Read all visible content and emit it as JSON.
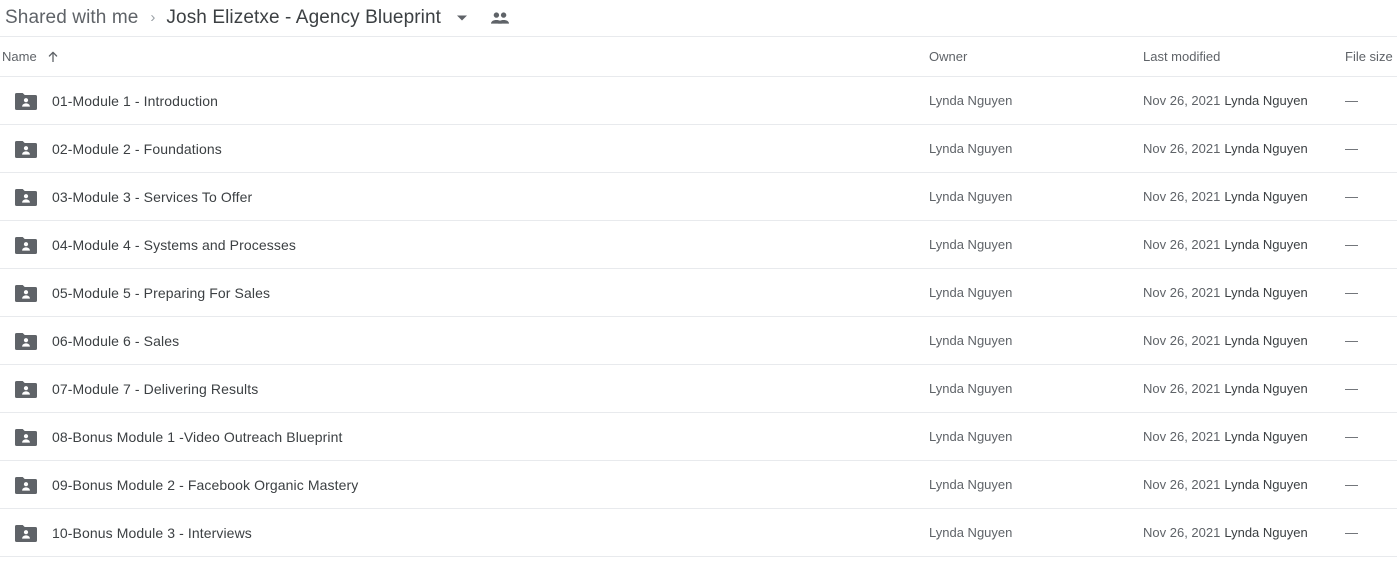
{
  "breadcrumb": {
    "root_label": "Shared with me",
    "separator": "›",
    "current_label": "Josh Elizetxe - Agency Blueprint",
    "caret_icon": "chevron-down-icon",
    "people_icon": "people-shared-icon"
  },
  "columns": {
    "name": "Name",
    "sort_icon": "arrow-up-icon",
    "owner": "Owner",
    "last_modified": "Last modified",
    "file_size": "File size"
  },
  "rows": [
    {
      "icon": "shared-folder-icon",
      "name": "01-Module 1 - Introduction",
      "owner": "Lynda Nguyen",
      "modified_date": "Nov 26, 2021",
      "modified_by": "Lynda Nguyen",
      "file_size": "—"
    },
    {
      "icon": "shared-folder-icon",
      "name": "02-Module 2 - Foundations",
      "owner": "Lynda Nguyen",
      "modified_date": "Nov 26, 2021",
      "modified_by": "Lynda Nguyen",
      "file_size": "—"
    },
    {
      "icon": "shared-folder-icon",
      "name": "03-Module 3 - Services To Offer",
      "owner": "Lynda Nguyen",
      "modified_date": "Nov 26, 2021",
      "modified_by": "Lynda Nguyen",
      "file_size": "—"
    },
    {
      "icon": "shared-folder-icon",
      "name": "04-Module 4 - Systems and Processes",
      "owner": "Lynda Nguyen",
      "modified_date": "Nov 26, 2021",
      "modified_by": "Lynda Nguyen",
      "file_size": "—"
    },
    {
      "icon": "shared-folder-icon",
      "name": "05-Module 5 - Preparing For Sales",
      "owner": "Lynda Nguyen",
      "modified_date": "Nov 26, 2021",
      "modified_by": "Lynda Nguyen",
      "file_size": "—"
    },
    {
      "icon": "shared-folder-icon",
      "name": "06-Module 6 - Sales",
      "owner": "Lynda Nguyen",
      "modified_date": "Nov 26, 2021",
      "modified_by": "Lynda Nguyen",
      "file_size": "—"
    },
    {
      "icon": "shared-folder-icon",
      "name": "07-Module 7 - Delivering Results",
      "owner": "Lynda Nguyen",
      "modified_date": "Nov 26, 2021",
      "modified_by": "Lynda Nguyen",
      "file_size": "—"
    },
    {
      "icon": "shared-folder-icon",
      "name": "08-Bonus Module 1 -Video Outreach Blueprint",
      "owner": "Lynda Nguyen",
      "modified_date": "Nov 26, 2021",
      "modified_by": "Lynda Nguyen",
      "file_size": "—"
    },
    {
      "icon": "shared-folder-icon",
      "name": "09-Bonus Module 2 - Facebook Organic Mastery",
      "owner": "Lynda Nguyen",
      "modified_date": "Nov 26, 2021",
      "modified_by": "Lynda Nguyen",
      "file_size": "—"
    },
    {
      "icon": "shared-folder-icon",
      "name": "10-Bonus Module 3 - Interviews",
      "owner": "Lynda Nguyen",
      "modified_date": "Nov 26, 2021",
      "modified_by": "Lynda Nguyen",
      "file_size": "—"
    }
  ],
  "colors": {
    "folder_icon": "#5f6368",
    "text_primary": "#3c4043",
    "text_secondary": "#5f6368",
    "divider": "#e8eaed"
  }
}
